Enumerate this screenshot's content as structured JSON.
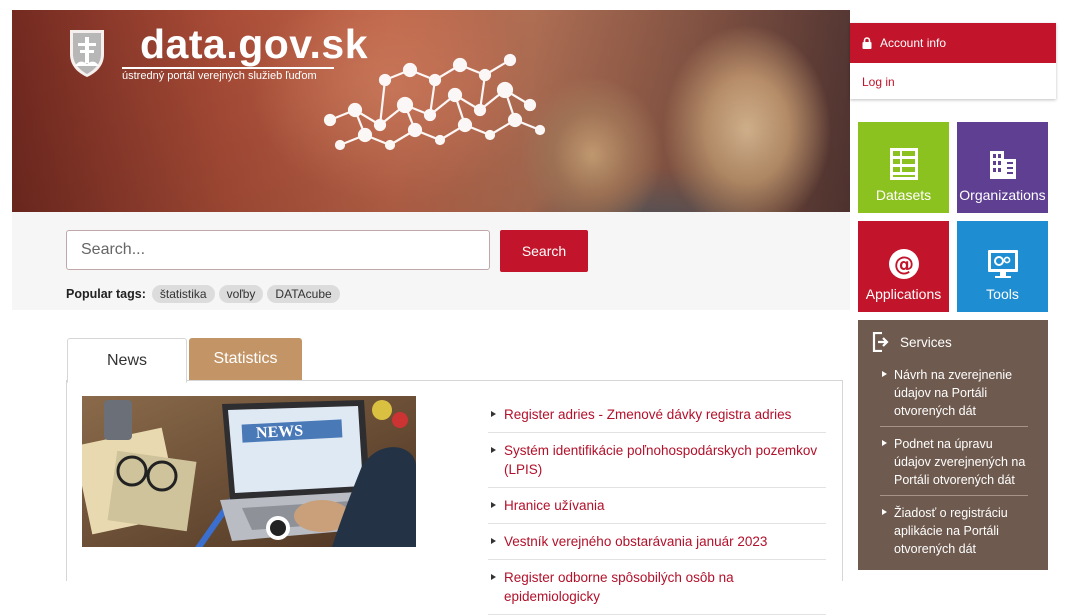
{
  "brand": {
    "title": "data.gov.sk",
    "subtitle": "ústredný portál verejných služieb ľuďom"
  },
  "search": {
    "placeholder": "Search...",
    "button_label": "Search",
    "popular_label": "Popular tags:",
    "tags": [
      "štatistika",
      "voľby",
      "DATAcube"
    ]
  },
  "account": {
    "header_label": "Account info",
    "login_label": "Log in"
  },
  "tiles": [
    {
      "label": "Datasets",
      "color": "#8cc220"
    },
    {
      "label": "Organizations",
      "color": "#5e3f92"
    },
    {
      "label": "Applications",
      "color": "#c2142a"
    },
    {
      "label": "Tools",
      "color": "#1e8dd1"
    }
  ],
  "services": {
    "title": "Services",
    "items": [
      "Návrh na zverejnenie údajov na Portáli otvorených dát",
      "Podnet na úpravu údajov zverejnených na Portáli otvorených dát",
      "Žiadosť o registráciu aplikácie na Portáli otvorených dát"
    ]
  },
  "tabs": {
    "news": "News",
    "statistics": "Statistics"
  },
  "news_image_caption": "NEWS",
  "news": [
    "Register adries - Zmenové dávky registra adries",
    "Systém identifikácie poľnohospodárskych pozemkov (LPIS)",
    "Hranice užívania",
    "Vestník verejného obstarávania január 2023",
    "Register odborne spôsobilých osôb na epidemiologicky"
  ],
  "colors": {
    "accent": "#c2142a",
    "stats_tab": "#c39566",
    "services_bg": "#6e5a4e"
  }
}
